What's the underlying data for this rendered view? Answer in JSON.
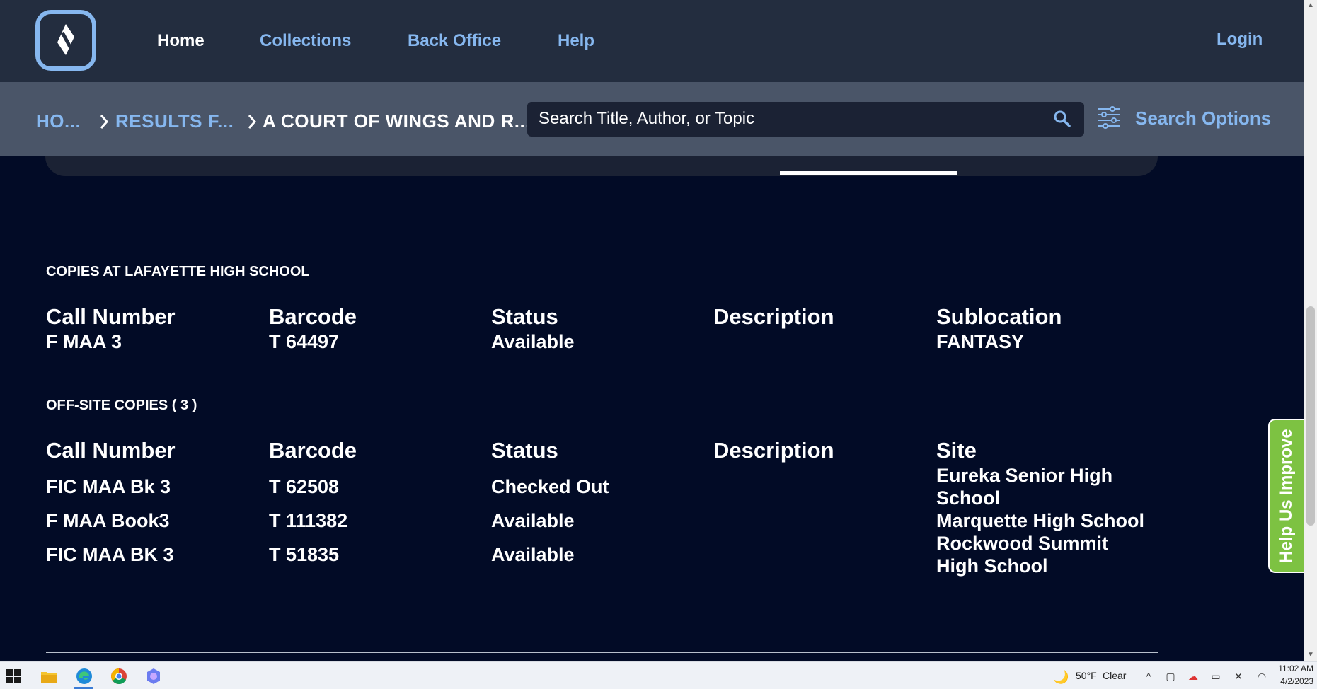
{
  "nav": {
    "home": "Home",
    "collections": "Collections",
    "back_office": "Back Office",
    "help": "Help",
    "login": "Login"
  },
  "breadcrumb": {
    "home": "HO...",
    "results": "RESULTS F...",
    "current": "A COURT OF WINGS AND R..."
  },
  "search": {
    "placeholder": "Search Title, Author, or Topic",
    "options_label": "Search Options"
  },
  "local_copies": {
    "title": "COPIES AT LAFAYETTE HIGH SCHOOL",
    "headers": [
      "Call Number",
      "Barcode",
      "Status",
      "Description",
      "Sublocation"
    ],
    "rows": [
      [
        "F MAA 3",
        "T 64497",
        "Available",
        "",
        "FANTASY"
      ]
    ]
  },
  "offsite_copies": {
    "title": "OFF-SITE COPIES ( 3 )",
    "headers": [
      "Call Number",
      "Barcode",
      "Status",
      "Description",
      "Site"
    ],
    "rows": [
      [
        "FIC MAA Bk 3",
        "T 62508",
        "Checked Out",
        "",
        "Eureka Senior High School"
      ],
      [
        "F MAA Book3",
        "T 111382",
        "Available",
        "",
        "Marquette High School"
      ],
      [
        "FIC MAA BK 3",
        "T 51835",
        "Available",
        "",
        "Rockwood Summit High School"
      ]
    ]
  },
  "help_tab": "Help Us Improve",
  "taskbar": {
    "weather": "50°F",
    "weather_desc": "Clear",
    "time": "11:02 AM",
    "date": "4/2/2023"
  },
  "colors": {
    "accent": "#86b7ef",
    "nav_bg": "#232d3f",
    "subbar_bg": "#4a5568",
    "page_bg": "#020b26",
    "help_tab": "#7dc242"
  }
}
